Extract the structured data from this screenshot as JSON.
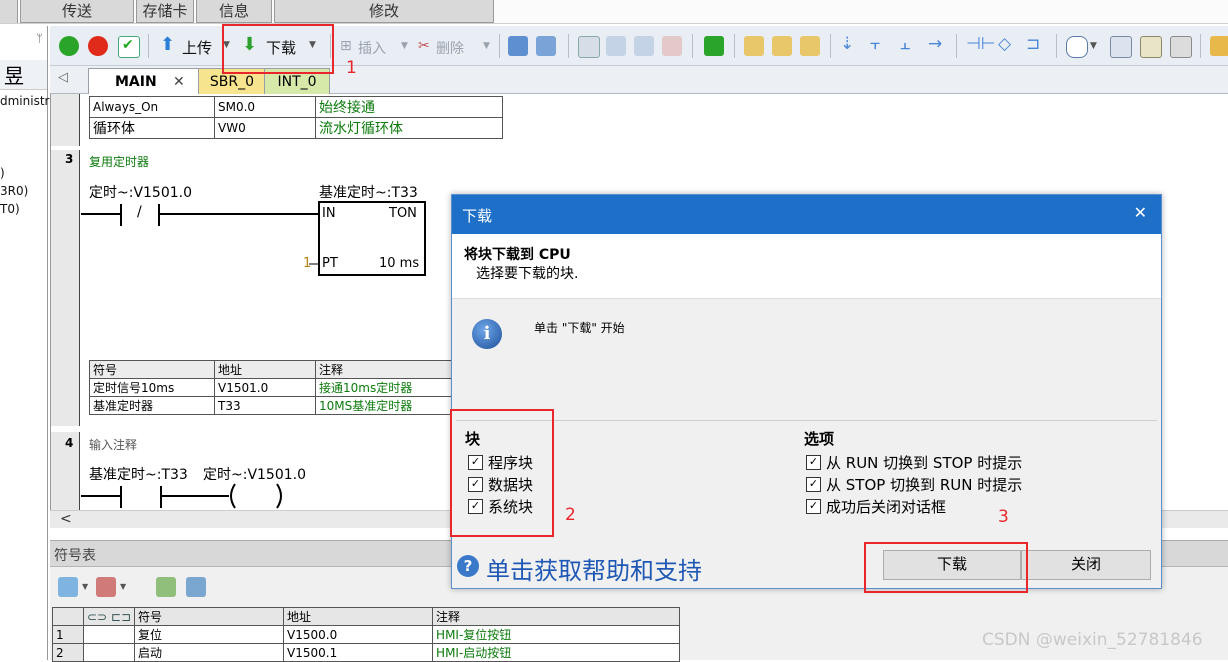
{
  "top_tabs": [
    "传送",
    "存储卡",
    "信息",
    "修改"
  ],
  "left_panel": {
    "big_char": "昱",
    "lines": [
      "dministr",
      ")",
      "3R0)",
      "T0)"
    ]
  },
  "toolbar": {
    "upload_label": "上传",
    "download_label": "下载",
    "insert_label": "插入",
    "delete_label": "删除"
  },
  "editor_tabs": [
    "MAIN",
    "SBR_0",
    "INT_0"
  ],
  "editor_tab_close": "✕",
  "network_top": {
    "rows": [
      [
        "Always_On",
        "SM0.0",
        "始终接通"
      ],
      [
        "循环体",
        "VW0",
        "流水灯循环体"
      ]
    ]
  },
  "network3": {
    "number": "3",
    "comment": "复用定时器",
    "contact_label": "定时~:V1501.0",
    "contact_symbol": "/",
    "timer_label": "基准定时~:T33",
    "timer_in": "IN",
    "timer_type": "TON",
    "timer_pt_value": "1",
    "timer_pt": "PT",
    "timer_base": "10 ms",
    "table_headers": [
      "符号",
      "地址",
      "注释"
    ],
    "table_rows": [
      [
        "定时信号10ms",
        "V1501.0",
        "接通10ms定时器"
      ],
      [
        "基准定时器",
        "T33",
        "10MS基准定时器"
      ]
    ]
  },
  "network4": {
    "number": "4",
    "comment": "输入注释",
    "label1": "基准定时~:T33",
    "label2": "定时~:V1501.0"
  },
  "scroll_left": "<",
  "symbol_panel": {
    "title": "符号表",
    "headers": [
      "符号",
      "地址",
      "注释"
    ],
    "rows": [
      [
        "1",
        "复位",
        "V1500.0",
        "HMI-复位按钮"
      ],
      [
        "2",
        "启动",
        "V1500.1",
        "HMI-启动按钮"
      ]
    ]
  },
  "dialog": {
    "title": "下载",
    "close_glyph": "✕",
    "heading": "将块下载到 CPU",
    "subheading": "选择要下载的块.",
    "info_text": "单击 \"下载\" 开始",
    "blocks_title": "块",
    "blocks": [
      "程序块",
      "数据块",
      "系统块"
    ],
    "options_title": "选项",
    "options": [
      "从 RUN 切换到 STOP 时提示",
      "从 STOP 切换到 RUN 时提示",
      "成功后关闭对话框"
    ],
    "help_link": "单击获取帮助和支持",
    "download_button": "下载",
    "close_button": "关闭"
  },
  "annotations": [
    "1",
    "2",
    "3"
  ],
  "watermark": "CSDN @weixin_52781846",
  "colors": {
    "title_blue": "#1e6fc8",
    "annotation_red": "#e8262c",
    "comment_green": "#0b7a0b"
  }
}
